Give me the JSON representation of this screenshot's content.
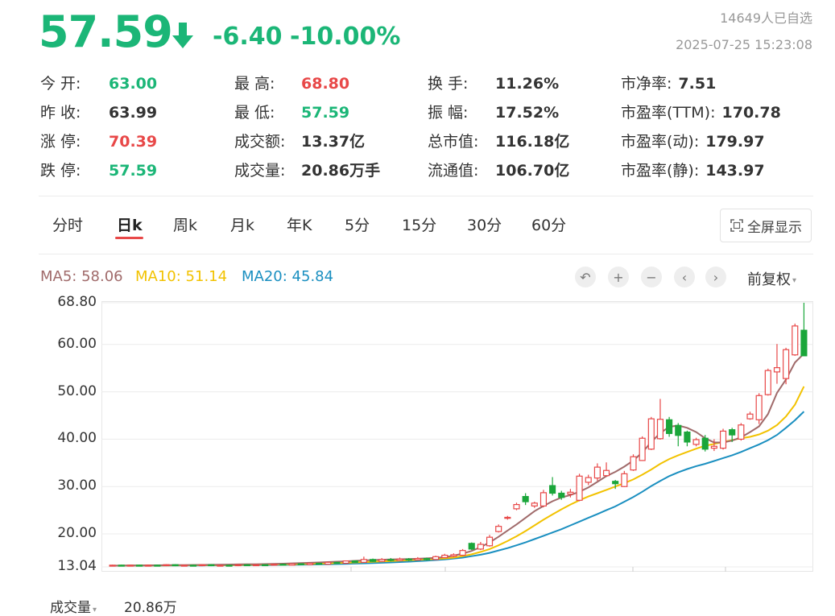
{
  "quote": {
    "price": "57.59",
    "change": "-6.40",
    "change_pct": "-10.00%",
    "followers": "14649人已自选",
    "timestamp": "2025-07-25 15:23:08"
  },
  "stats": [
    [
      {
        "label": "今 开:",
        "value": "63.00",
        "color": "green"
      },
      {
        "label": "最 高:",
        "value": "68.80",
        "color": "red"
      },
      {
        "label": "换 手:",
        "value": "11.26%",
        "color": "normal"
      },
      {
        "label": "市净率:",
        "value": "7.51",
        "color": "normal"
      }
    ],
    [
      {
        "label": "昨 收:",
        "value": "63.99",
        "color": "normal"
      },
      {
        "label": "最 低:",
        "value": "57.59",
        "color": "green"
      },
      {
        "label": "振 幅:",
        "value": "17.52%",
        "color": "normal"
      },
      {
        "label": "市盈率(TTM):",
        "value": "170.78",
        "color": "normal"
      }
    ],
    [
      {
        "label": "涨 停:",
        "value": "70.39",
        "color": "red"
      },
      {
        "label": "成交额:",
        "value": "13.37亿",
        "color": "normal"
      },
      {
        "label": "总市值:",
        "value": "116.18亿",
        "color": "normal"
      },
      {
        "label": "市盈率(动):",
        "value": "179.97",
        "color": "normal"
      }
    ],
    [
      {
        "label": "跌 停:",
        "value": "57.59",
        "color": "green"
      },
      {
        "label": "成交量:",
        "value": "20.86万手",
        "color": "normal"
      },
      {
        "label": "流通值:",
        "value": "106.70亿",
        "color": "normal"
      },
      {
        "label": "市盈率(静):",
        "value": "143.97",
        "color": "normal"
      }
    ]
  ],
  "tabs": [
    "分时",
    "日k",
    "周k",
    "月k",
    "年K",
    "5分",
    "15分",
    "30分",
    "60分"
  ],
  "active_tab": "日k",
  "fullscreen_label": "全屏显示",
  "ma": {
    "ma5": "MA5: 58.06",
    "ma5_color": "#a06a6a",
    "ma10": "MA10: 51.14",
    "ma10_color": "#f2c200",
    "ma20": "MA20: 45.84",
    "ma20_color": "#1a8fc0"
  },
  "controls": {
    "undo": "↶",
    "zoom_in": "+",
    "zoom_out": "−",
    "prev": "‹",
    "next": "›",
    "adjust_label": "前复权",
    "adjust_caret": "▾"
  },
  "volume": {
    "label": "成交量",
    "caret": "▾",
    "value": "20.86万"
  },
  "colors": {
    "up": "#e84848",
    "down": "#1aa63a",
    "price_down": "#1bb677"
  },
  "chart_data": {
    "type": "candlestick",
    "ylim": [
      13.04,
      68.8
    ],
    "yticks": [
      "68.80",
      "60.00",
      "50.00",
      "40.00",
      "30.00",
      "20.00",
      "13.04"
    ],
    "ytick_values": [
      68.8,
      60,
      50,
      40,
      30,
      20,
      13.04
    ],
    "candles": [
      [
        13.3,
        13.4,
        13.5,
        13.2
      ],
      [
        13.4,
        13.3,
        13.5,
        13.2
      ],
      [
        13.3,
        13.4,
        13.5,
        13.2
      ],
      [
        13.4,
        13.3,
        13.5,
        13.2
      ],
      [
        13.3,
        13.4,
        13.5,
        13.2
      ],
      [
        13.4,
        13.3,
        13.5,
        13.2
      ],
      [
        13.3,
        13.5,
        13.6,
        13.2
      ],
      [
        13.5,
        13.3,
        13.6,
        13.2
      ],
      [
        13.3,
        13.4,
        13.5,
        13.2
      ],
      [
        13.4,
        13.3,
        13.5,
        13.2
      ],
      [
        13.3,
        13.5,
        13.6,
        13.2
      ],
      [
        13.5,
        13.3,
        13.6,
        13.2
      ],
      [
        13.3,
        13.4,
        13.5,
        13.2
      ],
      [
        13.4,
        13.3,
        13.5,
        13.2
      ],
      [
        13.3,
        13.5,
        13.6,
        13.2
      ],
      [
        13.5,
        13.4,
        13.6,
        13.3
      ],
      [
        13.4,
        13.5,
        13.6,
        13.3
      ],
      [
        13.5,
        13.4,
        13.6,
        13.3
      ],
      [
        13.4,
        13.6,
        13.7,
        13.3
      ],
      [
        13.6,
        13.4,
        13.7,
        13.3
      ],
      [
        13.4,
        13.7,
        13.8,
        13.3
      ],
      [
        13.7,
        13.5,
        13.8,
        13.4
      ],
      [
        13.5,
        13.8,
        13.9,
        13.4
      ],
      [
        13.8,
        13.6,
        13.9,
        13.5
      ],
      [
        13.6,
        14.0,
        14.1,
        13.5
      ],
      [
        14.0,
        13.8,
        14.1,
        13.7
      ],
      [
        13.8,
        14.3,
        14.4,
        13.7
      ],
      [
        14.3,
        14.0,
        14.4,
        13.9
      ],
      [
        14.0,
        14.6,
        15.2,
        13.9
      ],
      [
        14.6,
        14.2,
        14.8,
        14.1
      ],
      [
        14.2,
        14.6,
        14.9,
        14.1
      ],
      [
        14.6,
        14.4,
        14.9,
        14.2
      ],
      [
        14.4,
        14.7,
        15.0,
        14.3
      ],
      [
        14.7,
        14.5,
        14.9,
        14.3
      ],
      [
        14.5,
        14.8,
        15.1,
        14.4
      ],
      [
        14.8,
        14.6,
        15.0,
        14.4
      ],
      [
        14.6,
        15.2,
        15.4,
        14.5
      ],
      [
        15.0,
        15.5,
        15.8,
        14.9
      ],
      [
        15.3,
        15.6,
        15.9,
        15.1
      ],
      [
        15.5,
        16.5,
        16.8,
        15.4
      ],
      [
        18.0,
        16.8,
        18.2,
        16.6
      ],
      [
        16.8,
        17.8,
        18.3,
        16.6
      ],
      [
        17.5,
        19.3,
        19.8,
        17.3
      ],
      [
        20.5,
        21.6,
        22.0,
        20.3
      ],
      [
        23.3,
        23.5,
        23.8,
        23.0
      ],
      [
        25.3,
        26.2,
        26.6,
        25.0
      ],
      [
        27.9,
        26.8,
        28.6,
        26.1
      ],
      [
        25.9,
        26.5,
        26.8,
        25.5
      ],
      [
        25.9,
        28.7,
        29.3,
        25.6
      ],
      [
        30.2,
        28.6,
        32.0,
        28.1
      ],
      [
        28.6,
        27.7,
        29.1,
        27.2
      ],
      [
        28.4,
        28.8,
        29.5,
        27.7
      ],
      [
        27.1,
        32.2,
        32.7,
        26.9
      ],
      [
        30.9,
        31.9,
        32.5,
        30.3
      ],
      [
        31.8,
        34.1,
        34.9,
        31.2
      ],
      [
        32.3,
        33.4,
        35.1,
        32.1
      ],
      [
        31.1,
        30.6,
        31.4,
        29.5
      ],
      [
        30.0,
        32.7,
        33.3,
        29.9
      ],
      [
        33.5,
        36.3,
        36.8,
        33.3
      ],
      [
        35.5,
        40.2,
        40.6,
        35.4
      ],
      [
        37.9,
        44.3,
        44.7,
        37.7
      ],
      [
        40.1,
        44.2,
        48.5,
        39.9
      ],
      [
        44.1,
        41.2,
        44.7,
        40.5
      ],
      [
        42.9,
        40.8,
        43.4,
        38.5
      ],
      [
        41.5,
        39.4,
        41.8,
        38.5
      ],
      [
        38.9,
        39.9,
        40.3,
        38.5
      ],
      [
        40.2,
        37.9,
        40.9,
        37.4
      ],
      [
        38.1,
        38.5,
        40.0,
        37.5
      ],
      [
        38.1,
        41.7,
        42.2,
        37.8
      ],
      [
        42.0,
        40.9,
        42.4,
        39.4
      ],
      [
        40.0,
        43.0,
        43.4,
        39.7
      ],
      [
        44.3,
        45.3,
        45.8,
        44.1
      ],
      [
        44.1,
        49.2,
        49.7,
        43.2
      ],
      [
        49.4,
        54.5,
        54.9,
        49.2
      ],
      [
        54.2,
        55.1,
        60.1,
        51.7
      ],
      [
        52.8,
        58.9,
        59.3,
        51.6
      ],
      [
        57.8,
        63.9,
        64.4,
        57.6
      ],
      [
        63.0,
        57.6,
        68.8,
        57.6
      ]
    ],
    "ma5": [
      13.3,
      13.32,
      13.33,
      13.35,
      13.36,
      13.38,
      13.4,
      13.42,
      13.43,
      13.45,
      13.47,
      13.48,
      13.5,
      13.53,
      13.56,
      13.58,
      13.6,
      13.64,
      13.68,
      13.72,
      13.78,
      13.84,
      13.9,
      13.98,
      14.06,
      14.14,
      14.22,
      14.32,
      14.4,
      14.48,
      14.56,
      14.62,
      14.66,
      14.7,
      14.76,
      14.84,
      14.95,
      15.1,
      15.4,
      15.85,
      16.4,
      17.2,
      18.2,
      19.4,
      20.7,
      22.0,
      23.4,
      24.8,
      25.9,
      26.9,
      27.7,
      28.2,
      28.9,
      29.8,
      31.0,
      32.2,
      33.1,
      34.2,
      35.5,
      37.2,
      39.4,
      41.3,
      42.6,
      42.9,
      42.4,
      41.5,
      40.2,
      39.3,
      39.3,
      39.7,
      40.4,
      41.5,
      42.7,
      45.3,
      49.8,
      52.6,
      56.2,
      58.06
    ],
    "ma10": [
      13.3,
      13.31,
      13.32,
      13.33,
      13.34,
      13.35,
      13.36,
      13.37,
      13.38,
      13.39,
      13.4,
      13.42,
      13.43,
      13.45,
      13.47,
      13.49,
      13.51,
      13.53,
      13.56,
      13.59,
      13.62,
      13.66,
      13.7,
      13.74,
      13.79,
      13.85,
      13.91,
      13.97,
      14.04,
      14.12,
      14.2,
      14.28,
      14.36,
      14.44,
      14.52,
      14.6,
      14.7,
      14.82,
      15.0,
      15.3,
      15.7,
      16.2,
      16.8,
      17.6,
      18.5,
      19.5,
      20.6,
      21.8,
      23.0,
      24.1,
      25.2,
      26.2,
      27.1,
      27.9,
      28.6,
      29.3,
      30.0,
      30.7,
      31.5,
      32.5,
      33.6,
      34.8,
      35.8,
      36.6,
      37.3,
      38.0,
      38.6,
      39.0,
      39.4,
      39.8,
      40.2,
      40.5,
      41.0,
      41.8,
      43.0,
      44.8,
      47.3,
      51.14
    ],
    "ma20": [
      13.3,
      13.3,
      13.31,
      13.31,
      13.32,
      13.32,
      13.33,
      13.33,
      13.34,
      13.35,
      13.35,
      13.36,
      13.37,
      13.38,
      13.39,
      13.4,
      13.41,
      13.43,
      13.45,
      13.47,
      13.49,
      13.51,
      13.54,
      13.57,
      13.6,
      13.64,
      13.68,
      13.73,
      13.78,
      13.84,
      13.9,
      13.98,
      14.06,
      14.15,
      14.25,
      14.36,
      14.48,
      14.62,
      14.8,
      15.0,
      15.3,
      15.6,
      16.0,
      16.5,
      17.0,
      17.6,
      18.2,
      18.9,
      19.6,
      20.3,
      21.0,
      21.8,
      22.6,
      23.4,
      24.2,
      25.0,
      25.8,
      26.8,
      27.8,
      28.9,
      30.1,
      31.2,
      32.2,
      33.0,
      33.7,
      34.3,
      34.8,
      35.4,
      36.0,
      36.6,
      37.3,
      38.1,
      38.9,
      39.8,
      40.9,
      42.4,
      44.0,
      45.84
    ]
  }
}
